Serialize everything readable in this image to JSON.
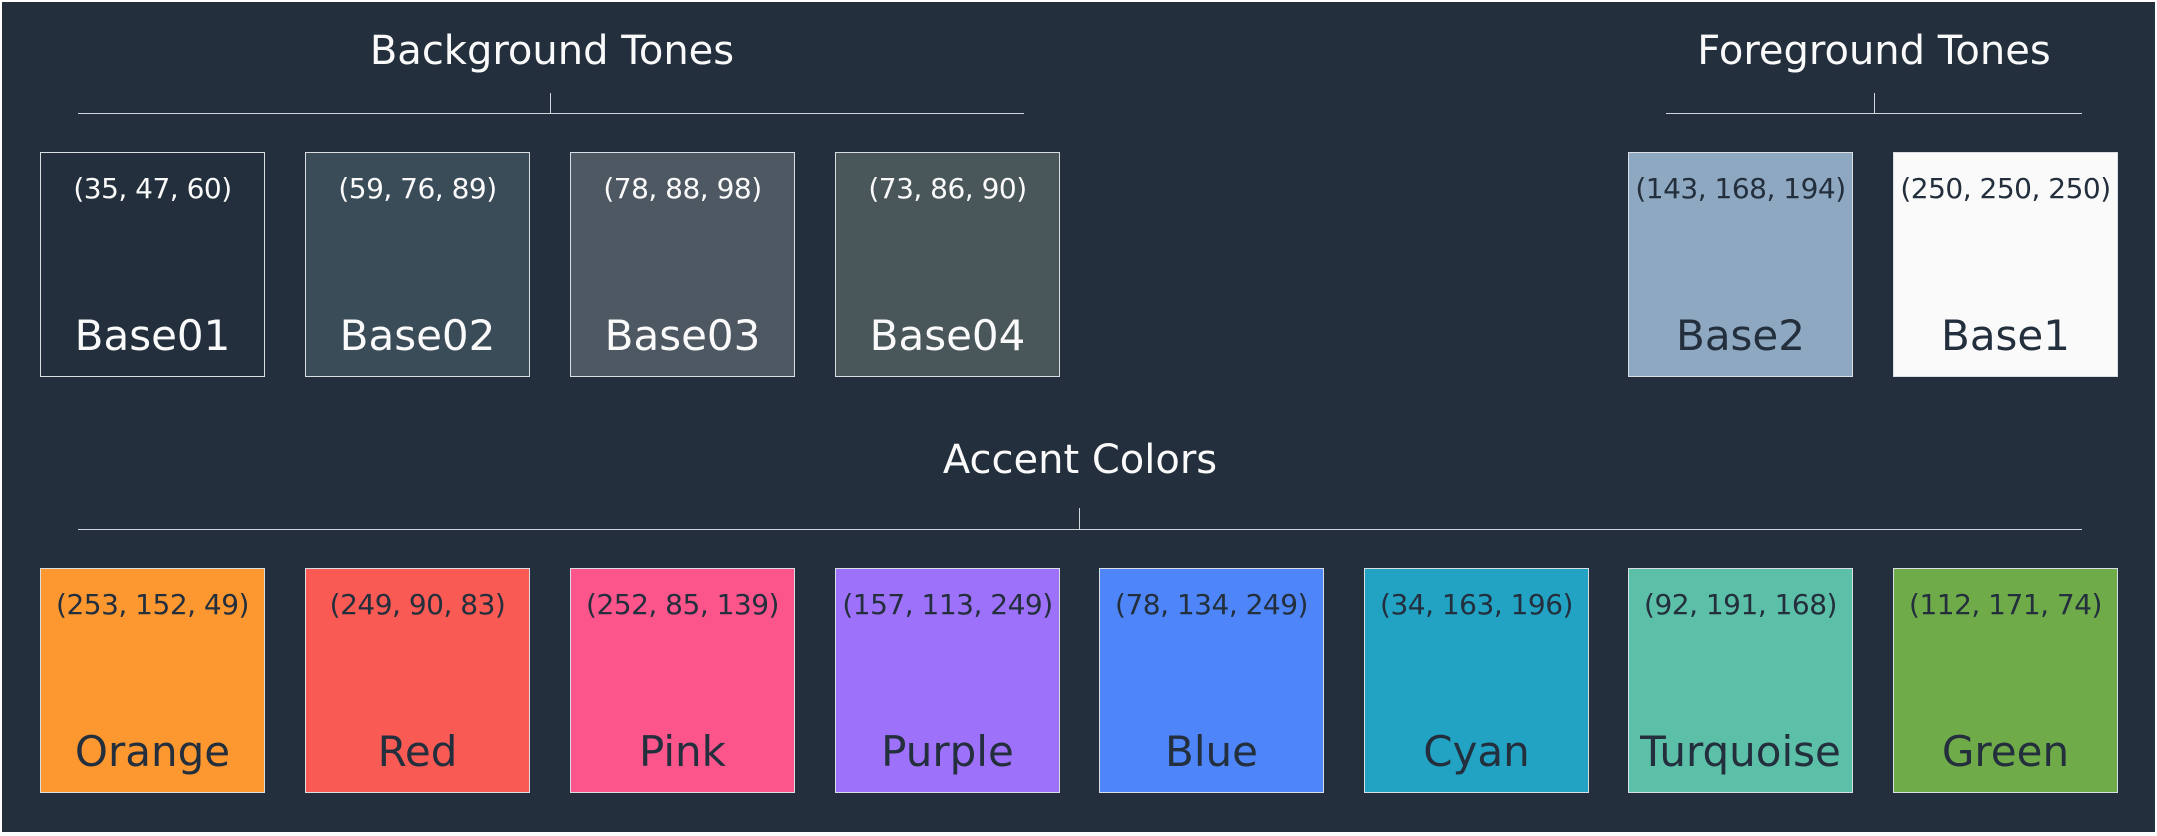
{
  "groups": {
    "background": {
      "title": "Background Tones",
      "swatches": [
        {
          "name": "Base01",
          "rgb": "(35, 47, 60)",
          "color": "#232f3c",
          "text_color": "#fafafa"
        },
        {
          "name": "Base02",
          "rgb": "(59, 76, 89)",
          "color": "#3b4c59",
          "text_color": "#fafafa"
        },
        {
          "name": "Base03",
          "rgb": "(78, 88, 98)",
          "color": "#4e5862",
          "text_color": "#fafafa"
        },
        {
          "name": "Base04",
          "rgb": "(73, 86, 90)",
          "color": "#49565a",
          "text_color": "#fafafa"
        }
      ]
    },
    "foreground": {
      "title": "Foreground Tones",
      "swatches": [
        {
          "name": "Base2",
          "rgb": "(143, 168, 194)",
          "color": "#8fa8c2",
          "text_color": "#232f3c"
        },
        {
          "name": "Base1",
          "rgb": "(250, 250, 250)",
          "color": "#fafafa",
          "text_color": "#232f3c"
        }
      ]
    },
    "accent": {
      "title": "Accent Colors",
      "swatches": [
        {
          "name": "Orange",
          "rgb": "(253, 152, 49)",
          "color": "#fd9831",
          "text_color": "#232f3c"
        },
        {
          "name": "Red",
          "rgb": "(249, 90, 83)",
          "color": "#f95a53",
          "text_color": "#232f3c"
        },
        {
          "name": "Pink",
          "rgb": "(252, 85, 139)",
          "color": "#fc558b",
          "text_color": "#232f3c"
        },
        {
          "name": "Purple",
          "rgb": "(157, 113, 249)",
          "color": "#9d71f9",
          "text_color": "#232f3c"
        },
        {
          "name": "Blue",
          "rgb": "(78, 134, 249)",
          "color": "#4e86f9",
          "text_color": "#232f3c"
        },
        {
          "name": "Cyan",
          "rgb": "(34, 163, 196)",
          "color": "#22a3c4",
          "text_color": "#232f3c"
        },
        {
          "name": "Turquoise",
          "rgb": "(92, 191, 168)",
          "color": "#5cbfa8",
          "text_color": "#232f3c"
        },
        {
          "name": "Green",
          "rgb": "(112, 171, 74)",
          "color": "#70ab4a",
          "text_color": "#232f3c"
        }
      ]
    }
  }
}
